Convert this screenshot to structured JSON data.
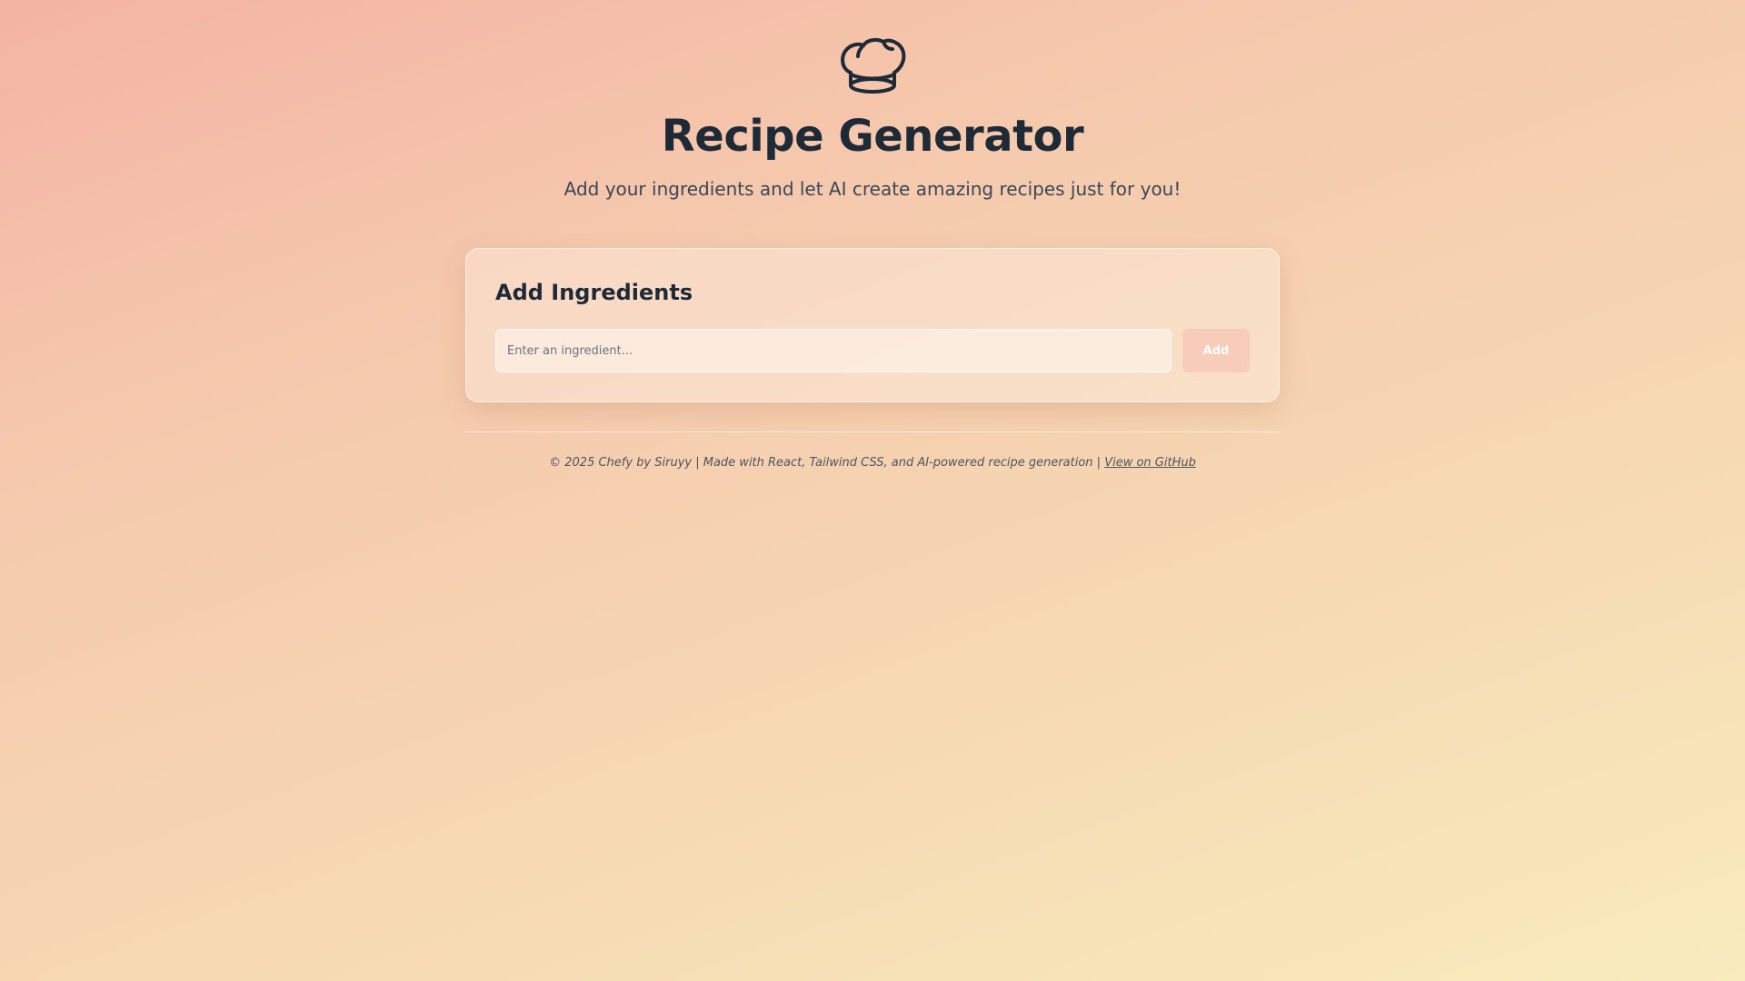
{
  "header": {
    "icon": "chef-hat-icon",
    "title": "Recipe Generator",
    "subtitle": "Add your ingredients and let AI create amazing recipes just for you!"
  },
  "card": {
    "title": "Add Ingredients",
    "input_placeholder": "Enter an ingredient...",
    "input_value": "",
    "add_label": "Add"
  },
  "footer": {
    "text": "© 2025 Chefy by Siruyy | Made with React, Tailwind CSS, and AI-powered recipe generation |",
    "link_label": "View on GitHub"
  },
  "colors": {
    "text": "#1f2a37",
    "gradient_start": "#f4b3a4",
    "gradient_end": "#f8ebbc",
    "button_disabled": "#f5beaf"
  }
}
